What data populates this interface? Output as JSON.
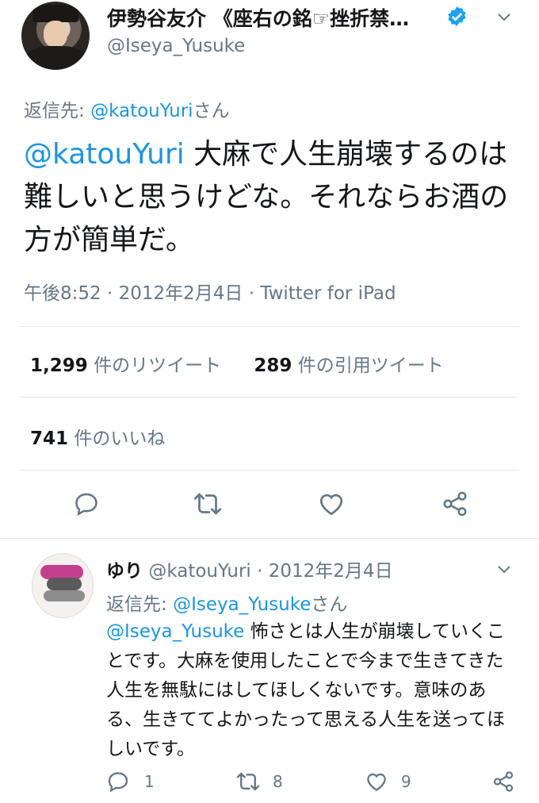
{
  "tweet": {
    "display_name": "伊勢谷友介 《座右の銘☞挫折禁…",
    "handle": "@Iseya_Yusuke",
    "reply_prefix": "返信先: ",
    "reply_to": "@katouYuri",
    "reply_suffix": "さん",
    "mention": "@katouYuri",
    "text": " 大麻で人生崩壊するのは難しいと思うけどな。それならお酒の方が簡単だ。",
    "time": "午後8:52",
    "date": "2012年2月4日",
    "source": "Twitter for iPad",
    "retweets_count": "1,299",
    "retweets_label": " 件のリツイート",
    "quotes_count": "289",
    "quotes_label": " 件の引用ツイート",
    "likes_count": "741",
    "likes_label": " 件のいいね"
  },
  "reply": {
    "display_name": "ゆり",
    "handle": "@katouYuri",
    "date": "2012年2月4日",
    "reply_prefix": "返信先: ",
    "reply_to": "@Iseya_Yusuke",
    "reply_suffix": "さん",
    "mention": "@Iseya_Yusuke",
    "text": " 怖さとは人生が崩壊していくことです。大麻を使用したことで今まで生きてきた人生を無駄にはしてほしくないです。意味のある、生きててよかったって思える人生を送ってほしいです。",
    "reply_count": "1",
    "retweet_count": "8",
    "like_count": "9"
  },
  "colors": {
    "accent": "#1b95e0",
    "muted": "#657786",
    "divider": "#e1e8ed"
  },
  "icons": [
    "verified-badge",
    "chevron-down",
    "reply",
    "retweet",
    "like",
    "share"
  ]
}
